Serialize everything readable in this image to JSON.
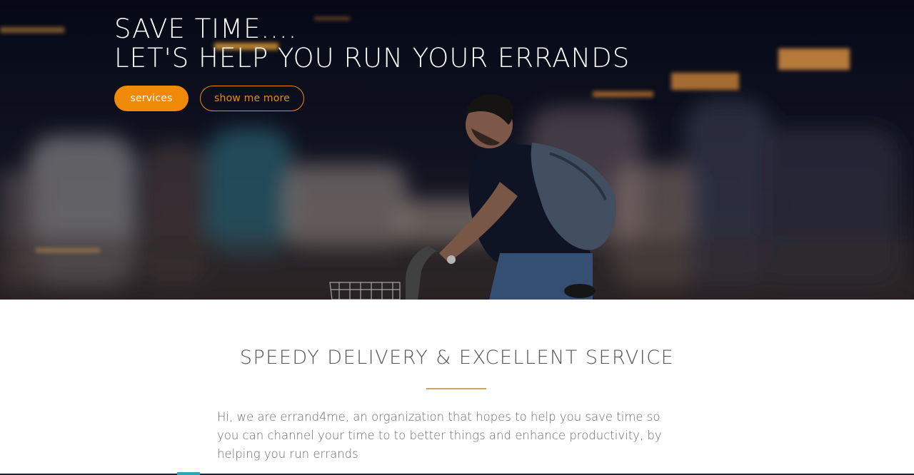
{
  "hero": {
    "headline_line1": "SAVE TIME....",
    "headline_line2": "LET'S HELP YOU RUN YOUR ERRANDS",
    "primary_button": "services",
    "secondary_button": "show me more",
    "background_image": "blurred-city-street-cyclist-photo"
  },
  "intro": {
    "title": "SPEEDY DELIVERY & EXCELLENT SERVICE",
    "body": "Hi, we are errand4me, an organization that hopes to help you save time so you can channel your time to to better things and enhance productivity, by helping you run errands"
  },
  "colors": {
    "accent": "#ef8a08",
    "divider": "#c9a266",
    "hero_bg": "#0b0d1c",
    "title_text": "#555555",
    "body_text": "#6b6b6b"
  }
}
